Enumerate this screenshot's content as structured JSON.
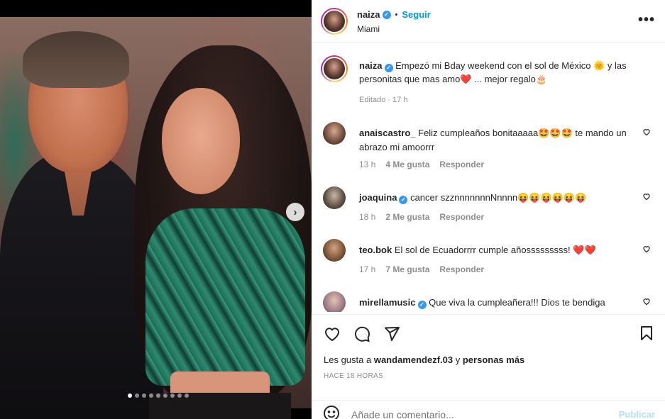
{
  "post": {
    "username": "naiza",
    "follow_label": "Seguir",
    "separator": "•",
    "location": "Miami",
    "more_label": "•••",
    "caption": "Empezó mi Bday weekend con el sol de México 🌞 y las personitas que mas amo❤️ ... mejor regalo🎂",
    "edited": "Editado · 17 h"
  },
  "comments": [
    {
      "username": "anaiscastro_",
      "verified": false,
      "text": "Feliz cumpleaños bonitaaaaa🤩🤩🤩 te mando un abrazo mi amoorrr",
      "time": "13 h",
      "likes": "4 Me gusta",
      "reply": "Responder"
    },
    {
      "username": "joaquina",
      "verified": true,
      "text": "cancer szznnnnnnnNnnnn😝😝😝😝😝😝",
      "time": "18 h",
      "likes": "2 Me gusta",
      "reply": "Responder"
    },
    {
      "username": "teo.bok",
      "verified": false,
      "text": "El sol de Ecuadorrrr cumple añosssssssss! ❤️❤️",
      "time": "17 h",
      "likes": "7 Me gusta",
      "reply": "Responder"
    },
    {
      "username": "mirellamusic",
      "verified": true,
      "text": "Que viva la cumpleañera!!! Dios te bendiga siempre!!! ❤️",
      "time": "",
      "likes": "",
      "reply": ""
    }
  ],
  "likes": {
    "prefix": "Les gusta a",
    "user": "wandamendezf.03",
    "middle": "y",
    "others": "personas más"
  },
  "timestamp": "HACE 18 HORAS",
  "add_comment": {
    "placeholder": "Añade un comentario...",
    "publish_label": "Publicar"
  },
  "carousel": {
    "total": 9,
    "active_index": 0
  },
  "colors": {
    "accent": "#0095f6",
    "verified": "#3897f0",
    "muted": "#8e8e8e",
    "publish_disabled": "#b2dffc"
  }
}
